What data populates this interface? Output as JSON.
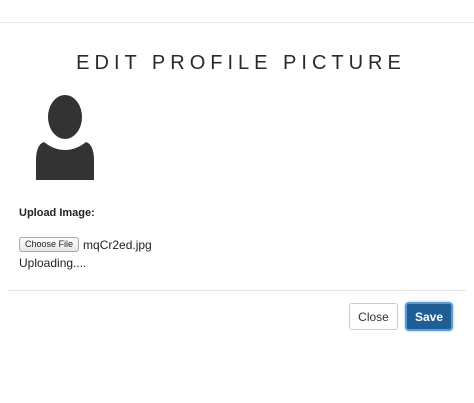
{
  "modal": {
    "title": "EDIT PROFILE PICTURE",
    "avatar_icon": "user-silhouette-icon"
  },
  "upload": {
    "label": "Upload Image:",
    "choose_file_label": "Choose File",
    "file_name": "mqCr2ed.jpg",
    "status": "Uploading...."
  },
  "footer": {
    "close_label": "Close",
    "save_label": "Save"
  },
  "colors": {
    "save_button_bg": "#1f5d95",
    "avatar_fill": "#333333"
  }
}
